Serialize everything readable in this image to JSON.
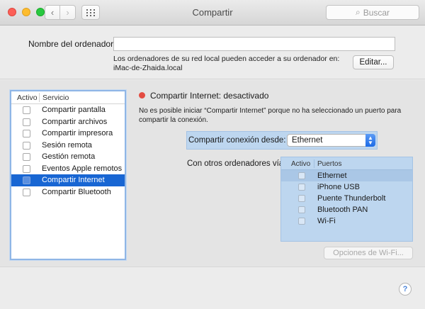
{
  "window": {
    "title": "Compartir",
    "search_placeholder": "Buscar",
    "nav_back_icon": "‹",
    "nav_forward_icon": "›",
    "search_icon": "⌕"
  },
  "computer_name": {
    "label": "Nombre del ordenador:",
    "value": "",
    "info_line1": "Los ordenadores de su red local pueden acceder a su ordenador en:",
    "info_line2": "iMac-de-Zhaida.local",
    "edit_button": "Editar..."
  },
  "services": {
    "header_active": "Activo",
    "header_service": "Servicio",
    "items": [
      {
        "label": "Compartir pantalla",
        "checked": false,
        "selected": false
      },
      {
        "label": "Compartir archivos",
        "checked": false,
        "selected": false
      },
      {
        "label": "Compartir impresora",
        "checked": false,
        "selected": false
      },
      {
        "label": "Sesión remota",
        "checked": false,
        "selected": false
      },
      {
        "label": "Gestión remota",
        "checked": false,
        "selected": false
      },
      {
        "label": "Eventos Apple remotos",
        "checked": false,
        "selected": false
      },
      {
        "label": "Compartir Internet",
        "checked": false,
        "selected": true
      },
      {
        "label": "Compartir Bluetooth",
        "checked": false,
        "selected": false
      }
    ]
  },
  "detail": {
    "status": "Compartir Internet: desactivado",
    "status_color": "#e34b41",
    "description": "No es posible iniciar “Compartir Internet” porque no ha seleccionado un puerto para compartir la conexión.",
    "share_from_label": "Compartir conexión desde:",
    "share_from_value": "Ethernet",
    "others_label": "Con otros ordenadores vía:",
    "ports_header_active": "Activo",
    "ports_header_ports": "Puertos",
    "ports": [
      {
        "label": "Ethernet",
        "checked": false,
        "highlighted": true
      },
      {
        "label": "iPhone USB",
        "checked": false,
        "highlighted": false
      },
      {
        "label": "Puente Thunderbolt",
        "checked": false,
        "highlighted": false
      },
      {
        "label": "Bluetooth PAN",
        "checked": false,
        "highlighted": false
      },
      {
        "label": "Wi-Fi",
        "checked": false,
        "highlighted": false
      }
    ],
    "wifi_options_button": "Opciones de Wi-Fi..."
  },
  "footer": {
    "help_label": "?"
  },
  "colors": {
    "selection": "#1866d3",
    "panel_blue": "#bdd6ef"
  }
}
